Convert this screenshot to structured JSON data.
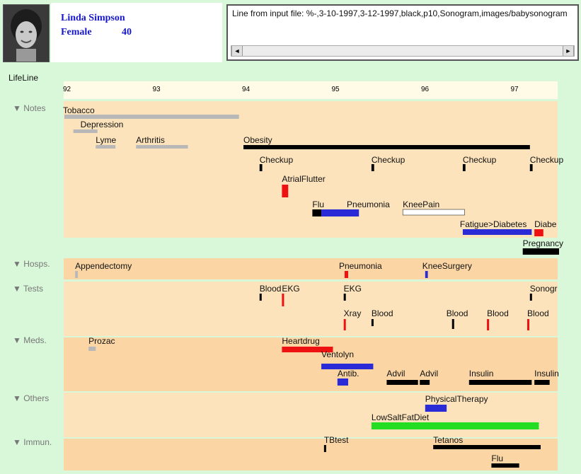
{
  "patient": {
    "name": "Linda Simpson",
    "sex": "Female",
    "age": "40"
  },
  "input_line": "Line from input file:  %-,3-10-1997,3-12-1997,black,p10,Sonogram,images/babysonogram",
  "scroll": {
    "left": "◄",
    "right": "►"
  },
  "title": "LifeLine",
  "years": [
    "92",
    "93",
    "94",
    "95",
    "96",
    "97"
  ],
  "colors": {
    "black": "#000000",
    "gray": "#b8b8b8",
    "red": "#ee1111",
    "blue": "#2a2ad6",
    "white": "#ffffff",
    "green": "#22dd22",
    "panel": "#fce3bb",
    "panel_alt": "#fbd6a4",
    "timeline": "#fffbe6"
  },
  "sections": [
    {
      "label": "▼ Notes"
    },
    {
      "label": "▼ Hosps."
    },
    {
      "label": "▼ Tests"
    },
    {
      "label": "▼ Meds."
    },
    {
      "label": "▼ Others"
    },
    {
      "label": "▼ Immun."
    }
  ],
  "items": [
    {
      "label": "Tobacco",
      "color": "gray",
      "segs": [
        [
          1992.0,
          1993.95
        ]
      ]
    },
    {
      "label": "Depression",
      "color": "gray",
      "segs": [
        [
          1992.1,
          1992.37
        ]
      ]
    },
    {
      "label": "Lyme",
      "color": "gray",
      "segs": [
        [
          1992.35,
          1992.57
        ]
      ]
    },
    {
      "label": "Arthritis",
      "color": "gray",
      "segs": [
        [
          1992.8,
          1993.38
        ]
      ]
    },
    {
      "label": "Obesity",
      "color": "black",
      "segs": [
        [
          1994.0,
          1997.2
        ]
      ]
    },
    {
      "label": "Checkup",
      "color": "black",
      "segs": [
        [
          1994.18,
          1994.21
        ]
      ]
    },
    {
      "label": "Checkup",
      "color": "black",
      "segs": [
        [
          1995.43,
          1995.46
        ]
      ]
    },
    {
      "label": "Checkup",
      "color": "black",
      "segs": [
        [
          1996.45,
          1996.48
        ]
      ]
    },
    {
      "label": "Checkup",
      "color": "black",
      "segs": [
        [
          1997.2,
          1997.23
        ]
      ]
    },
    {
      "label": "AtrialFlutter",
      "color": "red",
      "segs": [
        [
          1994.43,
          1994.5
        ]
      ]
    },
    {
      "label": "Flu",
      "color": "black",
      "segs": [
        [
          1994.77,
          1994.87
        ]
      ]
    },
    {
      "label": "Pneumonia",
      "color": "blue",
      "segs": [
        [
          1994.87,
          1995.29
        ]
      ]
    },
    {
      "label": "KneePain",
      "color": "white",
      "segs": [
        [
          1995.78,
          1996.47
        ]
      ]
    },
    {
      "label": "Fatigue>Diabetes",
      "color": "blue",
      "segs": [
        [
          1996.45,
          1997.22
        ]
      ]
    },
    {
      "label": "Diabe",
      "color": "red",
      "segs": [
        [
          1997.25,
          1997.35
        ]
      ]
    },
    {
      "label": "Pregnancy",
      "color": "black",
      "segs": [
        [
          1997.12,
          1997.59
        ]
      ]
    },
    {
      "label": "Appendectomy",
      "color": "gray",
      "segs": [
        [
          1992.12,
          1992.15
        ]
      ]
    },
    {
      "label": "Pneumonia",
      "color": "red",
      "segs": [
        [
          1995.13,
          1995.17
        ]
      ]
    },
    {
      "label": "KneeSurgery",
      "color": "blue",
      "segs": [
        [
          1996.03,
          1996.06
        ]
      ]
    },
    {
      "label": "Blood",
      "color": "black",
      "segs": [
        [
          1994.18,
          1994.2
        ]
      ]
    },
    {
      "label": "EKG",
      "color": "red",
      "segs": [
        [
          1994.43,
          1994.45
        ]
      ]
    },
    {
      "label": "EKG",
      "color": "black",
      "segs": [
        [
          1995.12,
          1995.14
        ]
      ]
    },
    {
      "label": "Sonogr",
      "color": "black",
      "segs": [
        [
          1997.2,
          1997.22
        ]
      ]
    },
    {
      "label": "Xray",
      "color": "red",
      "segs": [
        [
          1995.12,
          1995.14
        ]
      ]
    },
    {
      "label": "Blood",
      "color": "black",
      "segs": [
        [
          1995.43,
          1995.45
        ]
      ]
    },
    {
      "label": "Blood",
      "color": "black",
      "segs": [
        [
          1996.33,
          1996.35
        ]
      ]
    },
    {
      "label": "Blood",
      "color": "red",
      "segs": [
        [
          1996.72,
          1996.74
        ]
      ]
    },
    {
      "label": "Blood",
      "color": "red",
      "segs": [
        [
          1997.17,
          1997.19
        ]
      ]
    },
    {
      "label": "Prozac",
      "color": "gray",
      "segs": [
        [
          1992.27,
          1992.35
        ]
      ]
    },
    {
      "label": "Heartdrug",
      "color": "red",
      "segs": [
        [
          1994.43,
          1995.0
        ]
      ]
    },
    {
      "label": "Ventolyn",
      "color": "blue",
      "segs": [
        [
          1994.87,
          1995.45
        ]
      ]
    },
    {
      "label": "Antib.",
      "color": "blue",
      "segs": [
        [
          1995.05,
          1995.17
        ]
      ]
    },
    {
      "label": "Advil",
      "color": "black",
      "segs": [
        [
          1995.6,
          1995.95
        ]
      ]
    },
    {
      "label": "Advil",
      "color": "black",
      "segs": [
        [
          1995.97,
          1996.08
        ]
      ]
    },
    {
      "label": "Insulin",
      "color": "black",
      "segs": [
        [
          1996.52,
          1997.22
        ]
      ]
    },
    {
      "label": "Insulin",
      "color": "black",
      "segs": [
        [
          1997.25,
          1997.42
        ]
      ]
    },
    {
      "label": "PhysicalTherapy",
      "color": "blue",
      "segs": [
        [
          1996.03,
          1996.27
        ]
      ]
    },
    {
      "label": "LowSaltFatDiet",
      "color": "green",
      "segs": [
        [
          1995.43,
          1997.3
        ]
      ]
    },
    {
      "label": "TBtest",
      "color": "black",
      "segs": [
        [
          1994.9,
          1994.92
        ]
      ]
    },
    {
      "label": "Tetanos",
      "color": "black",
      "segs": [
        [
          1996.12,
          1997.32
        ]
      ]
    },
    {
      "label": "Flu",
      "color": "black",
      "segs": [
        [
          1996.77,
          1997.08
        ]
      ]
    }
  ]
}
